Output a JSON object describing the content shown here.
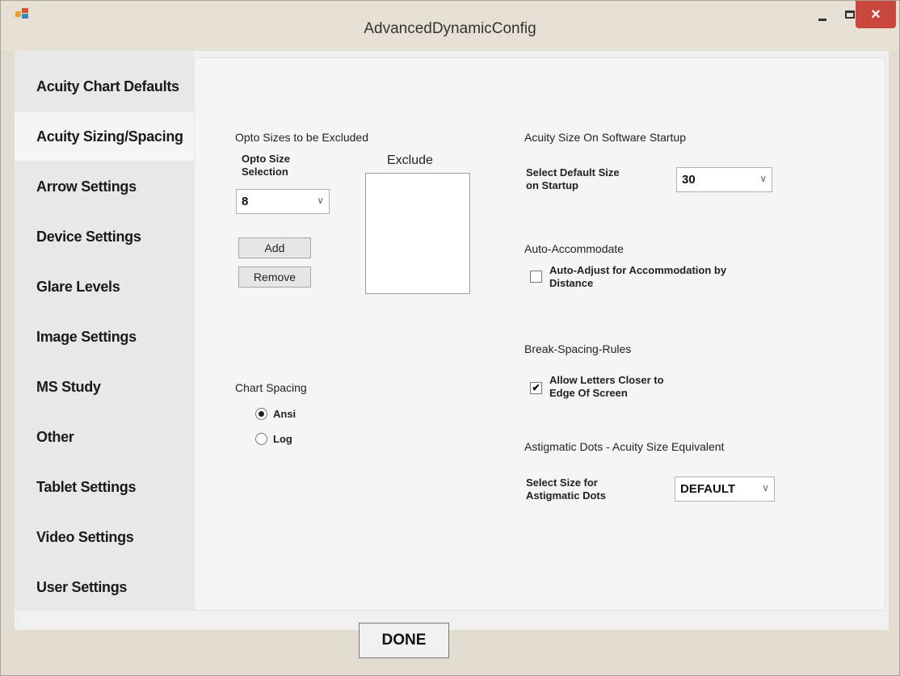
{
  "window": {
    "title": "AdvancedDynamicConfig",
    "close_glyph": "×"
  },
  "tabs": [
    {
      "label": "Acuity Chart Defaults"
    },
    {
      "label": "Acuity Sizing/Spacing",
      "selected": true
    },
    {
      "label": "Arrow Settings"
    },
    {
      "label": "Device Settings"
    },
    {
      "label": "Glare Levels"
    },
    {
      "label": "Image Settings"
    },
    {
      "label": "MS Study"
    },
    {
      "label": "Other"
    },
    {
      "label": "Tablet Settings"
    },
    {
      "label": "Video Settings"
    },
    {
      "label": "User Settings"
    }
  ],
  "exclude_group": {
    "title": "Opto Sizes to be Excluded",
    "selection_label": "Opto Size Selection",
    "selection_value": "8",
    "list_label": "Exclude",
    "add_label": "Add",
    "remove_label": "Remove"
  },
  "chart_spacing": {
    "title": "Chart Spacing",
    "options": [
      {
        "label": "Ansi",
        "checked": true
      },
      {
        "label": "Log",
        "checked": false
      }
    ]
  },
  "startup": {
    "title": "Acuity Size On Software Startup",
    "label": "Select Default Size on Startup",
    "value": "30"
  },
  "auto_accommodate": {
    "title": "Auto-Accommodate",
    "checkbox_label": "Auto-Adjust for Accommodation by Distance",
    "checked": false
  },
  "break_spacing": {
    "title": "Break-Spacing-Rules",
    "checkbox_label": "Allow Letters Closer to Edge Of Screen",
    "checked": true,
    "check_glyph": "✔"
  },
  "astigmatic": {
    "title": "Astigmatic Dots - Acuity Size Equivalent",
    "label": "Select Size for Astigmatic Dots",
    "value": "DEFAULT"
  },
  "dropdown_glyph": "∨",
  "done_label": "DONE"
}
